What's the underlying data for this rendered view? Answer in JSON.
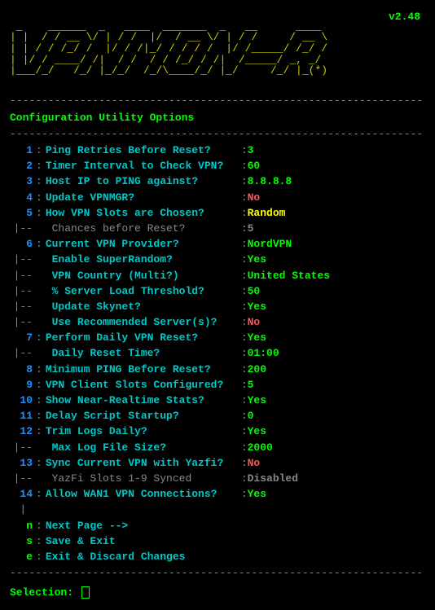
{
  "version": "v2.48",
  "ascii_art": " _    ______  _   ____  _______  _   __      ____ \n| |  / / __ \\/ | / /  |/  / __ \\/ | / /     / __ \\\n| | / / /_/ /  |/ / /|_/ / / / /  |/ /_____/ /_/ /\n| |/ / ____/ /|  / /  / / /_/ / /|  /_____/ _, _/ \n|___/_/   /_/ |_/_/  /_/\\____/_/ |_/     /_/ |_(*)",
  "section_title": "Configuration Utility Options",
  "dash_line": "-----------------------------------------------------------------",
  "rows": [
    {
      "num": "1",
      "type": "main",
      "label": "Ping Retries Before Reset?",
      "value": "3",
      "vclass": "val-green"
    },
    {
      "num": "2",
      "type": "main",
      "label": "Timer Interval to Check VPN?",
      "value": "60",
      "vclass": "val-green"
    },
    {
      "num": "3",
      "type": "main",
      "label": "Host IP to PING against?",
      "value": "8.8.8.8",
      "vclass": "val-green"
    },
    {
      "num": "4",
      "type": "main",
      "label": "Update VPNMGR?",
      "value": "No",
      "vclass": "val-red"
    },
    {
      "num": "5",
      "type": "main",
      "label": "How VPN Slots are Chosen?",
      "value": "Random",
      "vclass": "val-yellow"
    },
    {
      "num": "|--",
      "type": "sub",
      "label": " Chances before Reset?",
      "value": "5",
      "vclass": "val-gray"
    },
    {
      "num": "6",
      "type": "main",
      "label": "Current VPN Provider?",
      "value": "NordVPN",
      "vclass": "val-green"
    },
    {
      "num": "|--",
      "type": "subc",
      "label": " Enable SuperRandom?",
      "value": "Yes",
      "vclass": "val-green"
    },
    {
      "num": "|--",
      "type": "subc",
      "label": " VPN Country (Multi?)",
      "value": "United States",
      "vclass": "val-green"
    },
    {
      "num": "|--",
      "type": "subc",
      "label": " % Server Load Threshold?",
      "value": "50",
      "vclass": "val-green"
    },
    {
      "num": "|--",
      "type": "subc",
      "label": " Update Skynet?",
      "value": "Yes",
      "vclass": "val-green"
    },
    {
      "num": "|--",
      "type": "subc",
      "label": " Use Recommended Server(s)?",
      "value": "No",
      "vclass": "val-red"
    },
    {
      "num": "7",
      "type": "main",
      "label": "Perform Daily VPN Reset?",
      "value": "Yes",
      "vclass": "val-green"
    },
    {
      "num": "|--",
      "type": "subc",
      "label": " Daily Reset Time?",
      "value": "01:00",
      "vclass": "val-green"
    },
    {
      "num": "8",
      "type": "main",
      "label": "Minimum PING Before Reset?",
      "value": "200",
      "vclass": "val-green"
    },
    {
      "num": "9",
      "type": "main",
      "label": "VPN Client Slots Configured?",
      "value": "5",
      "vclass": "val-green"
    },
    {
      "num": "10",
      "type": "main",
      "label": "Show Near-Realtime Stats?",
      "value": "Yes",
      "vclass": "val-green"
    },
    {
      "num": "11",
      "type": "main",
      "label": "Delay Script Startup?",
      "value": "0",
      "vclass": "val-green"
    },
    {
      "num": "12",
      "type": "main",
      "label": "Trim Logs Daily?",
      "value": "Yes",
      "vclass": "val-green"
    },
    {
      "num": "|--",
      "type": "subc",
      "label": " Max Log File Size?",
      "value": "2000",
      "vclass": "val-green"
    },
    {
      "num": "13",
      "type": "main",
      "label": "Sync Current VPN with Yazfi?",
      "value": "No",
      "vclass": "val-red"
    },
    {
      "num": "|--",
      "type": "sub",
      "label": " YazFi Slots 1-9 Synced",
      "value": "Disabled",
      "vclass": "val-gray"
    },
    {
      "num": "14",
      "type": "main",
      "label": "Allow WAN1 VPN Connections?",
      "value": "Yes",
      "vclass": "val-green"
    }
  ],
  "actions": [
    {
      "key": "n",
      "label": "Next Page -->"
    },
    {
      "key": "s",
      "label": "Save & Exit"
    },
    {
      "key": "e",
      "label": "Exit & Discard Changes"
    }
  ],
  "selection_label": "Selection:"
}
